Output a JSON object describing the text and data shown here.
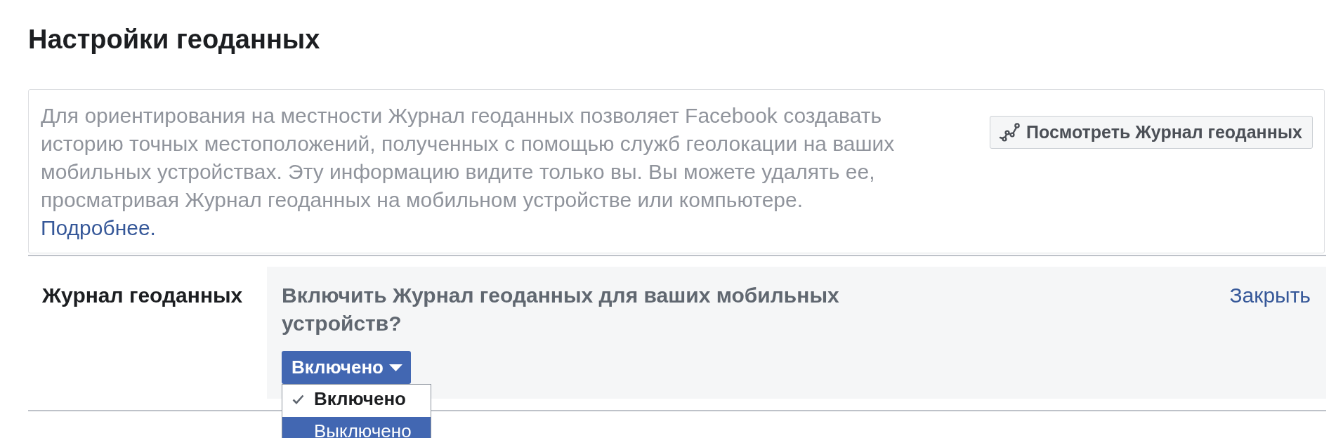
{
  "page": {
    "title": "Настройки геоданных"
  },
  "intro": {
    "lines": [
      "Для ориентирования на местности Журнал геоданных позволяет Facebook создавать",
      "историю точных местоположений, полученных с помощью служб геолокации на ваших",
      "мобильных устройствах. Эту информацию видите только вы. Вы можете удалять ее,",
      "просматривая Журнал геоданных на мобильном устройстве или компьютере."
    ],
    "link": "Подробнее.",
    "button": "Посмотреть Журнал геоданных"
  },
  "setting": {
    "label": "Журнал геоданных",
    "question": "Включить Журнал геоданных для ваших мобильных устройств?",
    "close_link": "Закрыть",
    "dropdown": {
      "value": "Включено",
      "expanded": true,
      "options": [
        {
          "label": "Включено",
          "selected": true,
          "highlighted": false
        },
        {
          "label": "Выключено",
          "selected": false,
          "highlighted": true
        }
      ]
    }
  }
}
